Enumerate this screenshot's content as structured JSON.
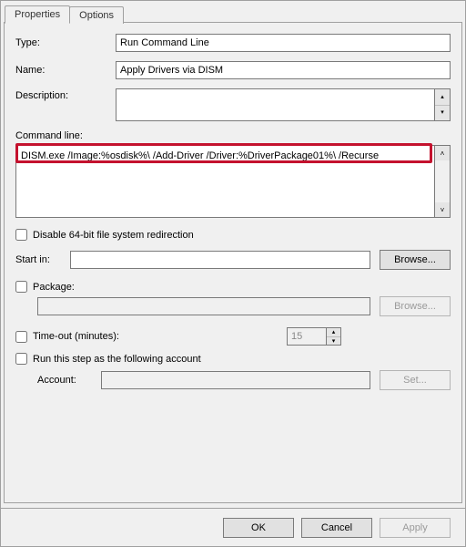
{
  "tabs": {
    "properties": "Properties",
    "options": "Options"
  },
  "fields": {
    "type_label": "Type:",
    "type_value": "Run Command Line",
    "name_label": "Name:",
    "name_value": "Apply Drivers via DISM",
    "description_label": "Description:",
    "description_value": "",
    "commandline_label": "Command line:",
    "commandline_value": "DISM.exe /Image:%osdisk%\\ /Add-Driver /Driver:%DriverPackage01%\\ /Recurse",
    "disable_redir_label": "Disable 64-bit file system redirection",
    "startin_label": "Start in:",
    "startin_value": "",
    "browse1": "Browse...",
    "package_label": "Package:",
    "package_value": "",
    "browse2": "Browse...",
    "timeout_label": "Time-out (minutes):",
    "timeout_value": "15",
    "runas_label": "Run this step as the following account",
    "account_label": "Account:",
    "account_value": "",
    "set_btn": "Set..."
  },
  "footer": {
    "ok": "OK",
    "cancel": "Cancel",
    "apply": "Apply"
  }
}
